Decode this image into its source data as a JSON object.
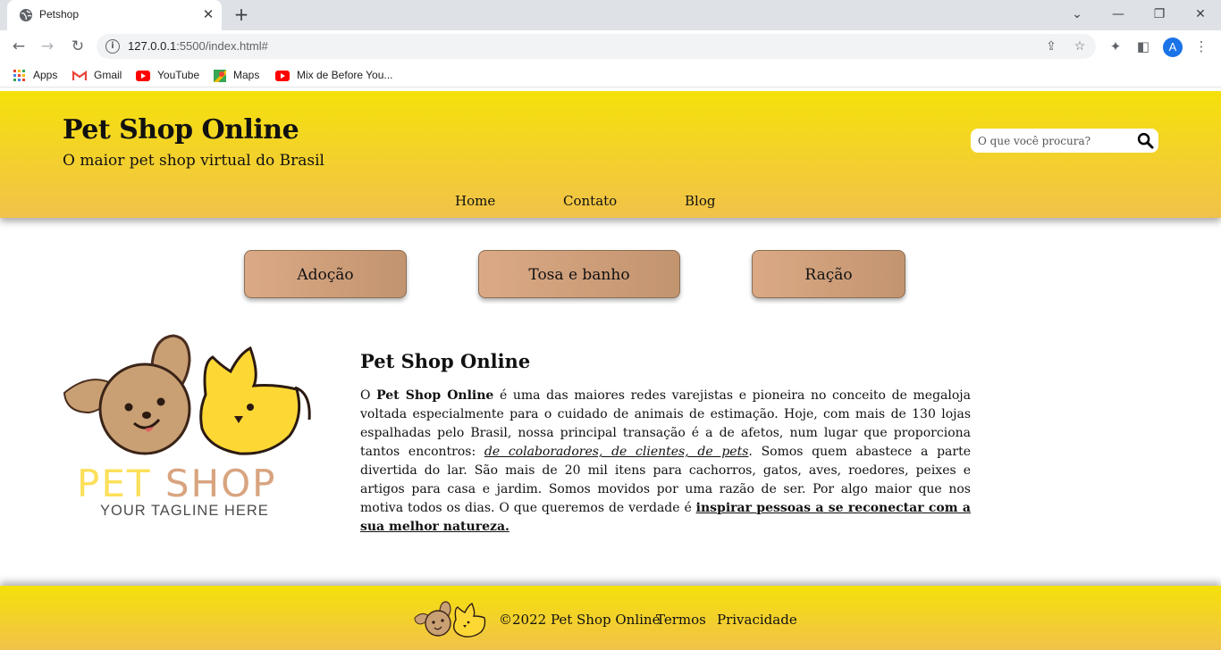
{
  "browser": {
    "tab_title": "Petshop",
    "url_host": "127.0.0.1",
    "url_rest": ":5500/index.html#",
    "avatar_letter": "A",
    "bookmarks": [
      "Apps",
      "Gmail",
      "YouTube",
      "Maps",
      "Mix de Before You..."
    ]
  },
  "header": {
    "title": "Pet Shop Online",
    "subtitle": "O maior pet shop virtual do Brasil",
    "search_placeholder": "O que você procura?",
    "nav": [
      "Home",
      "Contato",
      "Blog"
    ]
  },
  "services": [
    "Adoção",
    "Tosa e banho",
    "Ração"
  ],
  "logo": {
    "brand": "PET SHOP",
    "tagline": "YOUR TAGLINE HERE"
  },
  "about": {
    "title": "Pet Shop Online",
    "p1_start": "O ",
    "p1_bold": "Pet Shop Online",
    "p1_mid": " é uma das maiores redes varejistas e pioneira no conceito de megaloja voltada especialmente para o cuidado de animais de estimação. Hoje, com mais de 130 lojas espalhadas pelo Brasil, nossa principal transação é a de afetos, num lugar que proporciona tantos encontros: ",
    "p1_italic_link": "de colaboradores, de clientes, de pets",
    "p1_after": ". Somos quem abastece a parte divertida do lar. São mais de 20 mil itens para cachorros, gatos, aves, roedores, peixes e artigos para casa e jardim. Somos movidos por uma razão de ser. Por algo maior que nos motiva todos os dias. O que queremos de verdade é ",
    "p1_bold_link": "inspirar pessoas a se reconectar com a sua melhor natureza."
  },
  "footer": {
    "copyright": "©2022 Pet Shop Online",
    "links": [
      "Termos",
      "Privacidade"
    ]
  },
  "colors": {
    "header_top": "#f5e10a",
    "header_bottom": "#f1c24a",
    "button_left": "#dba985",
    "button_right": "#c2946f",
    "dog": "#c9a074",
    "cat": "#fdd835"
  }
}
